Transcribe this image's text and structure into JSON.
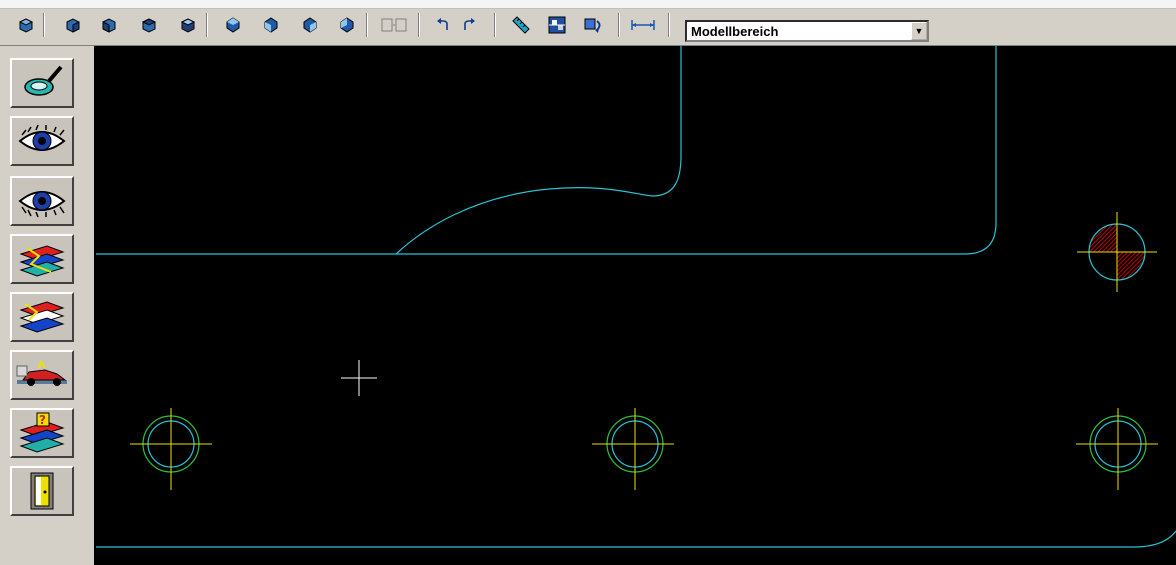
{
  "toolbar": {
    "view_buttons": [
      {
        "name": "view-top-button",
        "icon": "view-cube-icon"
      },
      {
        "name": "view-front-button",
        "icon": "view-cube-icon"
      },
      {
        "name": "view-left-button",
        "icon": "view-cube-icon"
      },
      {
        "name": "view-right-button",
        "icon": "view-cube-icon"
      },
      {
        "name": "view-bottom-button",
        "icon": "view-cube-icon"
      },
      {
        "name": "iso-sw-button",
        "icon": "iso-view-icon"
      },
      {
        "name": "iso-se-button",
        "icon": "iso-view-icon"
      },
      {
        "name": "iso-ne-button",
        "icon": "iso-view-icon"
      },
      {
        "name": "iso-nw-button",
        "icon": "iso-view-icon"
      },
      {
        "name": "viewports-button",
        "icon": "viewports-icon"
      },
      {
        "name": "undo-button",
        "icon": "undo-arrow-icon"
      },
      {
        "name": "redo-button",
        "icon": "redo-arrow-icon"
      },
      {
        "name": "measure-button",
        "icon": "ruler-icon"
      },
      {
        "name": "properties-button",
        "icon": "properties-icon"
      },
      {
        "name": "regen-button",
        "icon": "regen-icon"
      },
      {
        "name": "dimension-button",
        "icon": "dimension-icon"
      }
    ],
    "space_select": {
      "value": "Modellbereich"
    }
  },
  "side_panel": {
    "buttons": [
      {
        "name": "zoom-lens-button",
        "icon": "magnifier-icon"
      },
      {
        "name": "view-eye-button",
        "icon": "eye-icon"
      },
      {
        "name": "view-eye-2-button",
        "icon": "eye-icon"
      },
      {
        "name": "layer-button",
        "icon": "layer-stack-icon"
      },
      {
        "name": "layer-2-button",
        "icon": "layer-stack-icon"
      },
      {
        "name": "render-car-button",
        "icon": "car-icon"
      },
      {
        "name": "layer-help-button",
        "icon": "layer-question-icon"
      },
      {
        "name": "exit-door-button",
        "icon": "door-icon"
      }
    ]
  },
  "colors": {
    "canvas": "#000000",
    "contour": "#27c3d6",
    "centerline": "#f0e000",
    "hole": "#30c040",
    "hatch": "#c00000",
    "crosshair": "#ffffff"
  }
}
